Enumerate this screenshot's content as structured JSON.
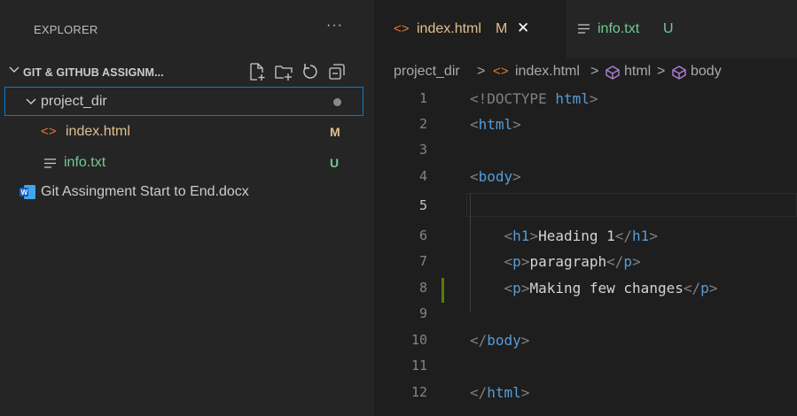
{
  "sidebar": {
    "title": "EXPLORER",
    "more": "···",
    "section_label": "GIT & GITHUB ASSIGNM...",
    "items": [
      {
        "label": "project_dir",
        "status": ""
      },
      {
        "label": "index.html",
        "status": "M"
      },
      {
        "label": "info.txt",
        "status": "U"
      },
      {
        "label": "Git Assingment Start to End.docx",
        "status": ""
      }
    ]
  },
  "tabs": [
    {
      "label": "index.html",
      "status": "M",
      "close": "✕"
    },
    {
      "label": "info.txt",
      "status": "U"
    }
  ],
  "breadcrumb": {
    "folder": "project_dir",
    "file": "index.html",
    "node1": "html",
    "node2": "body",
    "sep": ">"
  },
  "code": {
    "line_numbers": [
      "1",
      "2",
      "3",
      "4",
      "5",
      "6",
      "7",
      "8",
      "9",
      "10",
      "11",
      "12"
    ],
    "doctype_open": "<!DOCTYPE",
    "doctype_name": "html",
    "doctype_close": ">",
    "lt": "<",
    "gt": ">",
    "lt_slash": "</",
    "html": "html",
    "body": "body",
    "h1": "h1",
    "p": "p",
    "heading_text": "Heading 1",
    "para1": "paragraph",
    "para2": "Making few changes"
  },
  "colors": {
    "modified": "#e2c08d",
    "untracked": "#73c991",
    "focus_border": "#007fd4",
    "tag": "#569cd6"
  }
}
